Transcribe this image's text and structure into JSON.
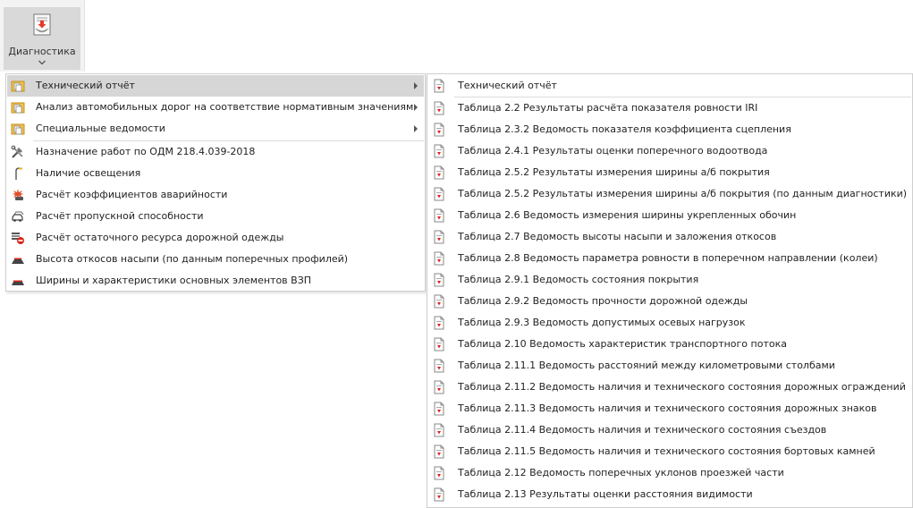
{
  "ribbon": {
    "diagnostics_label": "Диагностика",
    "icon": "diagnostics-report-icon"
  },
  "main_menu": {
    "items": [
      {
        "label": "Технический отчёт",
        "icon": "folder-report-icon",
        "submenu": true
      },
      {
        "label": "Анализ автомобильных дорог на соответствие нормативным значениям",
        "icon": "folder-report-icon",
        "submenu": true
      },
      {
        "label": "Специальные ведомости",
        "icon": "folder-report-icon",
        "submenu": true
      },
      {
        "label": "Назначение работ по ОДМ 218.4.039-2018",
        "icon": "tools-icon",
        "submenu": false
      },
      {
        "label": "Наличие освещения",
        "icon": "street-lamp-icon",
        "submenu": false
      },
      {
        "label": "Расчёт коэффициентов аварийности",
        "icon": "accident-icon",
        "submenu": false
      },
      {
        "label": "Расчёт пропускной способности",
        "icon": "traffic-cars-icon",
        "submenu": false
      },
      {
        "label": "Расчёт остаточного ресурса дорожной одежды",
        "icon": "pavement-resource-icon",
        "submenu": false
      },
      {
        "label": "Высота откосов насыпи (по данным поперечных профилей)",
        "icon": "embankment-profile-icon",
        "submenu": false
      },
      {
        "label": "Ширины и характеристики основных элементов ВЗП",
        "icon": "road-elements-icon",
        "submenu": false
      }
    ]
  },
  "sub_menu": {
    "items": [
      "Технический отчёт",
      "Таблица 2.2 Результаты расчёта показателя ровности IRI",
      "Таблица 2.3.2 Ведомость показателя коэффициента сцепления",
      "Таблица 2.4.1 Результаты оценки поперечного водоотвода",
      "Таблица 2.5.2 Результаты измерения ширины а/б покрытия",
      "Таблица 2.5.2 Результаты измерения ширины а/б покрытия (по данным диагностики)",
      "Таблица 2.6 Ведомость измерения ширины укрепленных обочин",
      "Таблица 2.7 Ведомость высоты насыпи и заложения откосов",
      "Таблица 2.8 Ведомость параметра ровности в поперечном направлении (колеи)",
      "Таблица 2.9.1 Ведомость состояния покрытия",
      "Таблица 2.9.2 Ведомость прочности дорожной одежды",
      "Таблица 2.9.3 Ведомость допустимых осевых нагрузок",
      "Таблица 2.10 Ведомость характеристик транспортного потока",
      "Таблица 2.11.1 Ведомость расстояний между километровыми столбами",
      "Таблица 2.11.2 Ведомость наличия и технического состояния дорожных ограждений",
      "Таблица 2.11.3 Ведомость наличия и технического состояния дорожных знаков",
      "Таблица 2.11.4 Ведомость наличия и технического состояния съездов",
      "Таблица 2.11.5 Ведомость наличия и технического состояния бортовых камней",
      "Таблица 2.12 Ведомость поперечных уклонов проезжей части",
      "Таблица 2.13 Результаты оценки расстояния видимости"
    ],
    "item_icon": "pdf-document-icon"
  },
  "colors": {
    "highlight": "#d6d6d6",
    "pdf_red": "#d9261c",
    "folder_gold": "#e0a21b"
  }
}
